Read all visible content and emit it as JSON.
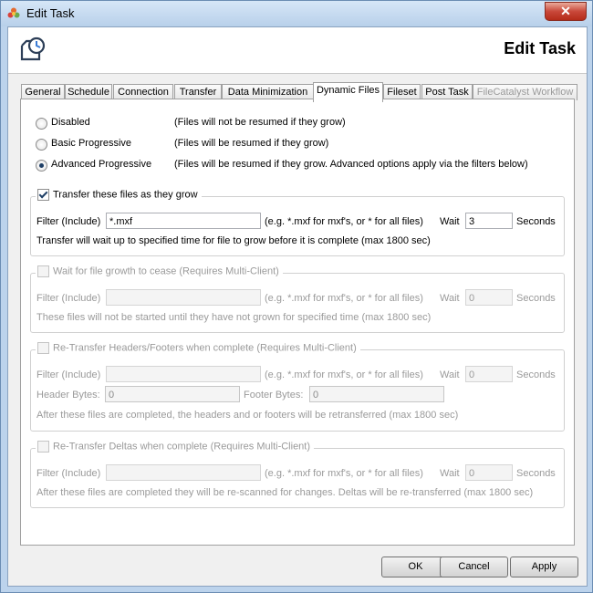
{
  "window": {
    "title": "Edit Task",
    "close_label": "✕"
  },
  "header": {
    "title": "Edit Task"
  },
  "tabs": [
    {
      "label": "General"
    },
    {
      "label": "Schedule"
    },
    {
      "label": "Connection"
    },
    {
      "label": "Transfer"
    },
    {
      "label": "Data Minimization"
    },
    {
      "label": "Dynamic Files"
    },
    {
      "label": "Fileset"
    },
    {
      "label": "Post Task"
    },
    {
      "label": "FileCatalyst Workflow"
    }
  ],
  "active_tab": "Dynamic Files",
  "modes": [
    {
      "label": "Disabled",
      "desc": "(Files will not be resumed if they grow)",
      "selected": false
    },
    {
      "label": "Basic Progressive",
      "desc": "(Files will be resumed if they grow)",
      "selected": false
    },
    {
      "label": "Advanced Progressive",
      "desc": "(Files will be resumed if they grow. Advanced options apply via the filters below)",
      "selected": true
    }
  ],
  "groups": {
    "transfer_growing": {
      "title": "Transfer these files as they grow",
      "checked": true,
      "filter_label": "Filter (Include)",
      "filter_value": "*.mxf",
      "hint": "(e.g. *.mxf for mxf's, or * for all files)",
      "wait_label": "Wait",
      "wait_value": "3",
      "unit": "Seconds",
      "note": "Transfer will wait up to specified time for file to grow before it is complete (max 1800 sec)"
    },
    "wait_cease": {
      "title": "Wait for file growth to cease (Requires Multi-Client)",
      "checked": false,
      "filter_label": "Filter (Include)",
      "filter_value": "",
      "hint": "(e.g. *.mxf for mxf's, or * for all files)",
      "wait_label": "Wait",
      "wait_value": "0",
      "unit": "Seconds",
      "note": "These files will not be started until they have not grown for specified time (max 1800 sec)"
    },
    "retransfer_headers": {
      "title": "Re-Transfer Headers/Footers when complete (Requires Multi-Client)",
      "checked": false,
      "filter_label": "Filter (Include)",
      "filter_value": "",
      "hint": "(e.g. *.mxf for mxf's, or * for all files)",
      "wait_label": "Wait",
      "wait_value": "0",
      "unit": "Seconds",
      "header_bytes_label": "Header Bytes:",
      "header_bytes_value": "0",
      "footer_bytes_label": "Footer Bytes:",
      "footer_bytes_value": "0",
      "note": "After these files are completed, the headers and or footers will be retransferred (max 1800 sec)"
    },
    "retransfer_deltas": {
      "title": "Re-Transfer Deltas when complete (Requires Multi-Client)",
      "checked": false,
      "filter_label": "Filter (Include)",
      "filter_value": "",
      "hint": "(e.g. *.mxf for mxf's, or * for all files)",
      "wait_label": "Wait",
      "wait_value": "0",
      "unit": "Seconds",
      "note": "After these files are completed they will be re-scanned for changes. Deltas will be re-transferred (max 1800 sec)"
    }
  },
  "buttons": {
    "ok": "OK",
    "cancel": "Cancel",
    "apply": "Apply"
  },
  "icons": {
    "app": "flower-app-icon",
    "header": "task-clock-icon"
  }
}
